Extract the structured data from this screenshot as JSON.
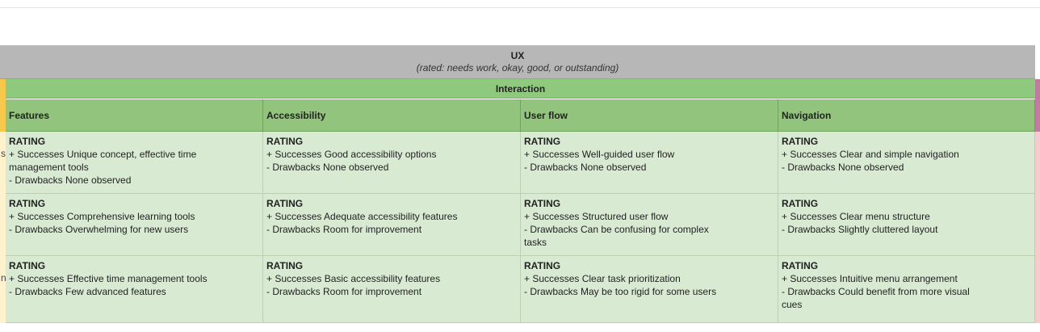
{
  "header": {
    "ux_title": "UX",
    "ux_subtitle": "(rated: needs work, okay, good, or outstanding)",
    "interaction": "Interaction"
  },
  "columns": [
    "Features",
    "Accessibility",
    "User flow",
    "Navigation"
  ],
  "rows": [
    {
      "edge_char": "s",
      "cells": [
        {
          "rating": "RATING",
          "lines": [
            "+ Successes  Unique concept, effective time",
            "management tools",
            " - Drawbacks None observed"
          ]
        },
        {
          "rating": "RATING",
          "lines": [
            "+ Successes  Good accessibility options",
            "- Drawbacks None observed"
          ]
        },
        {
          "rating": "RATING",
          "lines": [
            "+ Successes Well-guided user flow",
            "- Drawbacks None observed"
          ]
        },
        {
          "rating": "RATING",
          "lines": [
            "+ Successes Clear and simple navigation",
            "- Drawbacks None observed"
          ]
        }
      ]
    },
    {
      "edge_char": "",
      "cells": [
        {
          "rating": "RATING",
          "lines": [
            "+ Successes Comprehensive learning tools",
            "- Drawbacks  Overwhelming for new users"
          ]
        },
        {
          "rating": "RATING",
          "lines": [
            "+ Successes Adequate accessibility features",
            "- Drawbacks  Room for improvement"
          ]
        },
        {
          "rating": "RATING",
          "lines": [
            "+ Successes Structured user flow",
            "- Drawbacks Can be confusing for complex",
            "tasks"
          ]
        },
        {
          "rating": "RATING",
          "lines": [
            "+ Successes Clear menu structure",
            "- Drawbacks  Slightly cluttered layout"
          ]
        }
      ]
    },
    {
      "edge_char": "n",
      "cells": [
        {
          "rating": "RATING",
          "lines": [
            "+ Successes Effective time management tools",
            "- Drawbacks Few advanced features"
          ]
        },
        {
          "rating": "RATING",
          "lines": [
            "+ Successes Basic accessibility features",
            "- Drawbacks Room for improvement"
          ]
        },
        {
          "rating": "RATING",
          "lines": [
            "+ Successes Clear task prioritization",
            "- Drawbacks May be too rigid for some users"
          ]
        },
        {
          "rating": "RATING",
          "lines": [
            "+ Successes Intuitive menu arrangement",
            "- Drawbacks Could benefit from more visual",
            "cues"
          ]
        }
      ]
    }
  ],
  "colors": {
    "ux_band": "#b7b7b7",
    "interaction_band": "#8fc97e",
    "column_header": "#93c47d",
    "cell": "#d9ead3",
    "left_edge": "#f6c94c",
    "right_edge": "#c27ba0"
  }
}
